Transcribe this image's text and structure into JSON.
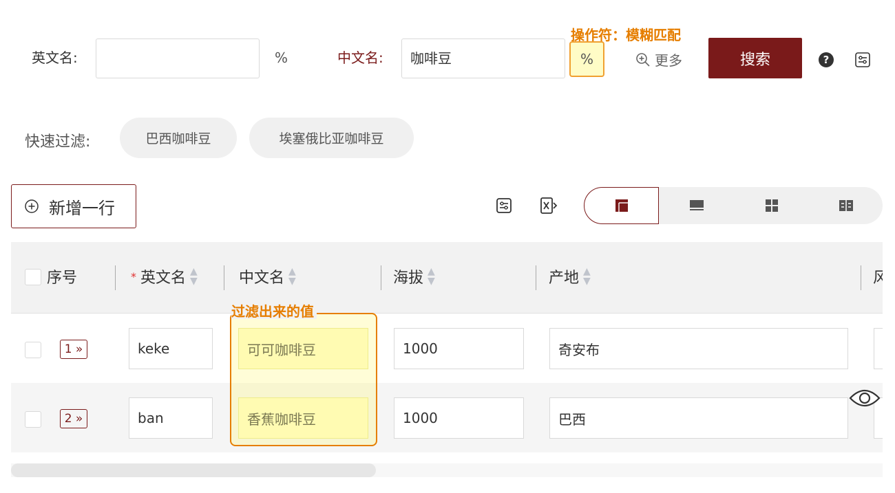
{
  "search": {
    "english_label": "英文名:",
    "english_value": "",
    "english_op": "%",
    "chinese_label": "中文名:",
    "chinese_value": "咖啡豆",
    "chinese_op": "%",
    "more_label": "更多",
    "search_button": "搜索"
  },
  "annotations": {
    "operator_note": "操作符：模糊匹配",
    "filter_note": "过滤出来的值"
  },
  "quick_filter": {
    "label": "快速过滤:",
    "chips": [
      "巴西咖啡豆",
      "埃塞俄比亚咖啡豆"
    ]
  },
  "toolbar": {
    "add_row_label": "新增一行"
  },
  "table": {
    "columns": [
      {
        "label": "序号",
        "sortable": false
      },
      {
        "label": "英文名",
        "required": true,
        "sortable": true
      },
      {
        "label": "中文名",
        "sortable": true
      },
      {
        "label": "海拔",
        "sortable": true
      },
      {
        "label": "产地",
        "sortable": true
      },
      {
        "label": "风",
        "sortable": false
      }
    ],
    "required_mark": "*",
    "rows": [
      {
        "index": "1 »",
        "english": "keke",
        "chinese": "可可咖啡豆",
        "altitude": "1000",
        "origin": "奇安布"
      },
      {
        "index": "2 »",
        "english": "ban",
        "chinese": "香蕉咖啡豆",
        "altitude": "1000",
        "origin": "巴西"
      }
    ]
  },
  "colors": {
    "primary": "#7a1a1a",
    "annotation": "#e67e00",
    "highlight": "#fffcc6"
  }
}
